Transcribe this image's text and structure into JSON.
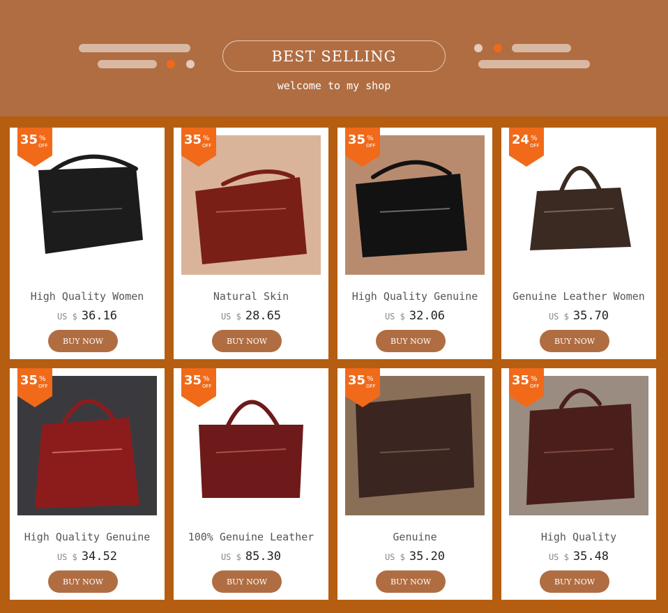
{
  "header": {
    "title": "BEST SELLING",
    "subtitle": "welcome to my shop"
  },
  "colors": {
    "page_background": "#b55e12",
    "header_background": "#b06d42",
    "badge": "#f06a1a",
    "button": "#b06d42"
  },
  "products": [
    {
      "discount": "35",
      "percent_sign": "%",
      "off": "OFF",
      "name": "High Quality Women",
      "currency": "US $",
      "price": "36.16",
      "button": "BUY NOW"
    },
    {
      "discount": "35",
      "percent_sign": "%",
      "off": "OFF",
      "name": "Natural Skin",
      "currency": "US $",
      "price": "28.65",
      "button": "BUY NOW"
    },
    {
      "discount": "35",
      "percent_sign": "%",
      "off": "OFF",
      "name": "High Quality Genuine",
      "currency": "US $",
      "price": "32.06",
      "button": "BUY NOW"
    },
    {
      "discount": "24",
      "percent_sign": "%",
      "off": "OFF",
      "name": "Genuine Leather Women",
      "currency": "US $",
      "price": "35.70",
      "button": "BUY NOW"
    },
    {
      "discount": "35",
      "percent_sign": "%",
      "off": "OFF",
      "name": "High Quality Genuine",
      "currency": "US $",
      "price": "34.52",
      "button": "BUY NOW"
    },
    {
      "discount": "35",
      "percent_sign": "%",
      "off": "OFF",
      "name": "100% Genuine Leather",
      "currency": "US $",
      "price": "85.30",
      "button": "BUY NOW"
    },
    {
      "discount": "35",
      "percent_sign": "%",
      "off": "OFF",
      "name": "Genuine",
      "currency": "US $",
      "price": "35.20",
      "button": "BUY NOW"
    },
    {
      "discount": "35",
      "percent_sign": "%",
      "off": "OFF",
      "name": "High Quality",
      "currency": "US $",
      "price": "35.48",
      "button": "BUY NOW"
    }
  ]
}
